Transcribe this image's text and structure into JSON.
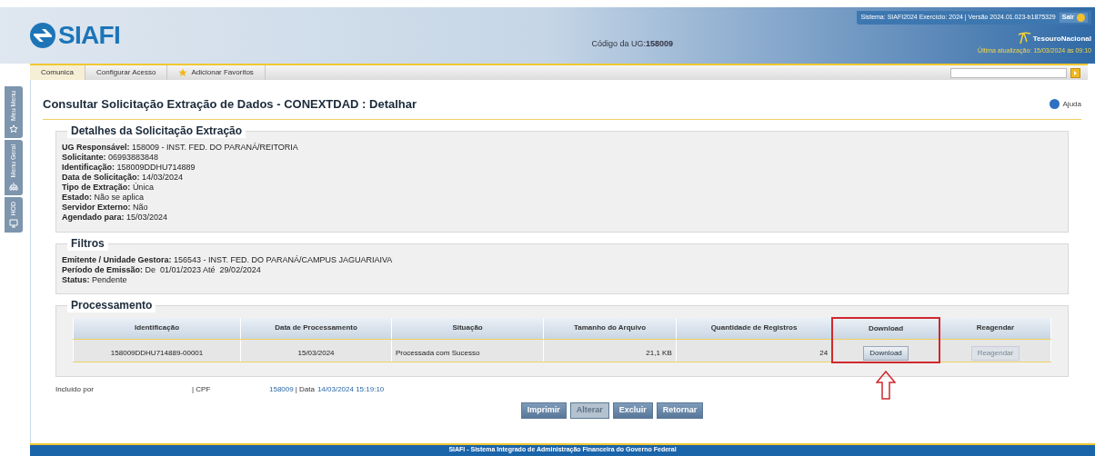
{
  "header": {
    "logo": "SIAFI",
    "ug_label": "Código da UG:",
    "ug_code": "158009",
    "system_info": "Sistema: SIAFI2024 Exercício: 2024 | Versão 2024.01.023-b1875329",
    "logout": "Sair",
    "brand": "TesouroNacional",
    "last_update": "Última atualização: 15/03/2024 às 09:10"
  },
  "menu": [
    {
      "label": "Comunica",
      "selected": true,
      "kind": "plain"
    },
    {
      "label": "Configurar Acesso",
      "selected": false,
      "kind": "plain"
    },
    {
      "label": "Adicionar Favoritos",
      "selected": false,
      "kind": "star"
    }
  ],
  "side_tabs": [
    {
      "label": "Meu Menu",
      "kind": "star"
    },
    {
      "label": "Menu Geral",
      "kind": "tree"
    },
    {
      "label": "HOD",
      "kind": "monitor"
    }
  ],
  "page_title": "Consultar Solicitação Extração de Dados - CONEXTDAD : Detalhar",
  "help": "Ajuda",
  "details": {
    "legend": "Detalhes da Solicitação Extração",
    "fields": [
      {
        "label": "UG Responsável:",
        "value": "158009 - INST. FED. DO PARANÁ/REITORIA"
      },
      {
        "label": "Solicitante:",
        "value": "06993883848"
      },
      {
        "label": "Identificação:",
        "value": "158009DDHU714889"
      },
      {
        "label": "Data de Solicitação:",
        "value": "14/03/2024"
      },
      {
        "label": "Tipo de Extração:",
        "value": "Única"
      },
      {
        "label": "Estado:",
        "value": "Não se aplica"
      },
      {
        "label": "Servidor Externo:",
        "value": "Não"
      },
      {
        "label": "Agendado para:",
        "value": "15/03/2024"
      }
    ]
  },
  "filters": {
    "legend": "Filtros",
    "fields": [
      {
        "label": "Emitente / Unidade Gestora:",
        "value": "156543 - INST. FED. DO PARANÁ/CAMPUS JAGUARIAIVA"
      },
      {
        "label": "Período de Emissão:",
        "value": "De  01/01/2023 Até  29/02/2024"
      },
      {
        "label": "Status:",
        "value": "Pendente"
      }
    ]
  },
  "processing": {
    "legend": "Processamento",
    "columns": [
      {
        "label": "Identificação",
        "highlighted": false
      },
      {
        "label": "Data de Processamento",
        "highlighted": false
      },
      {
        "label": "Situação",
        "highlighted": false
      },
      {
        "label": "Tamanho do Arquivo",
        "highlighted": false
      },
      {
        "label": "Quantidade de Registros",
        "highlighted": false
      },
      {
        "label": "Download",
        "highlighted": true
      },
      {
        "label": "Reagendar",
        "highlighted": false
      }
    ],
    "rows": [
      [
        {
          "kind": "text",
          "text": "158009DDHU714889-00001"
        },
        {
          "kind": "text",
          "text": "15/03/2024"
        },
        {
          "kind": "text",
          "text": "Processada com Sucesso"
        },
        {
          "kind": "text",
          "text": "21,1 KB"
        },
        {
          "kind": "text",
          "text": "24"
        },
        {
          "kind": "button",
          "text": "Download",
          "disabled": false
        },
        {
          "kind": "button",
          "text": "Reagendar",
          "disabled": true
        }
      ]
    ]
  },
  "audit": {
    "included_by": "Incluído por",
    "cpf": "| CPF",
    "ug": "158009",
    "date_label": "| Data",
    "date": "14/03/2024 15:19:10"
  },
  "actions": [
    {
      "label": "Imprimir",
      "disabled": false
    },
    {
      "label": "Alterar",
      "disabled": true
    },
    {
      "label": "Excluir",
      "disabled": false
    },
    {
      "label": "Retornar",
      "disabled": false
    }
  ],
  "footer": "SIAFI - Sistema Integrado de Administração Financeira do Governo Federal"
}
